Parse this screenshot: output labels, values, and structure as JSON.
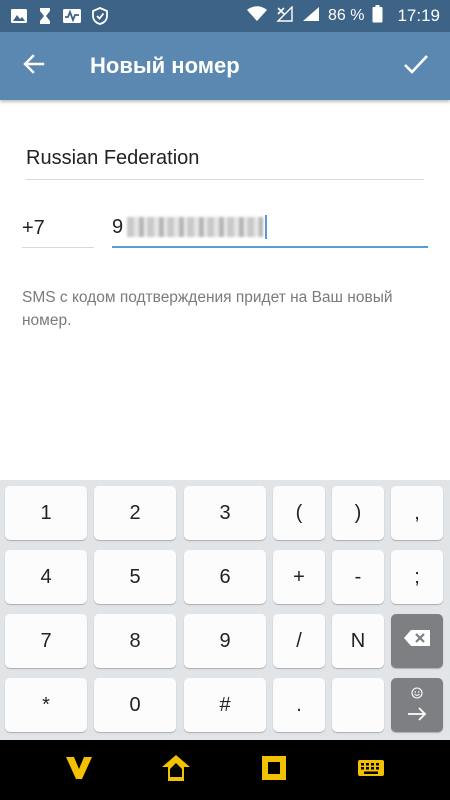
{
  "status_bar": {
    "icons": [
      "image-icon",
      "hourglass-icon",
      "activity-icon",
      "shield-icon",
      "wifi-icon",
      "no-signal-icon",
      "signal-icon"
    ],
    "battery": "86 %",
    "time": "17:19"
  },
  "app_bar": {
    "title": "Новый номер",
    "back_icon": "arrow-left-icon",
    "done_icon": "check-icon"
  },
  "form": {
    "country": "Russian Federation",
    "country_code": "+7",
    "phone_visible_prefix": "9",
    "hint": "SMS с кодом подтверждения придет на Ваш новый номер."
  },
  "keyboard": {
    "rows": [
      [
        "1",
        "2",
        "3",
        "(",
        ")",
        ","
      ],
      [
        "4",
        "5",
        "6",
        "+",
        "-",
        ";"
      ],
      [
        "7",
        "8",
        "9",
        "/",
        "N",
        "backspace"
      ],
      [
        "*",
        "0",
        "#",
        ".",
        "",
        "enter"
      ]
    ],
    "backspace_icon": "backspace-icon",
    "enter_icon": "arrow-right-icon",
    "emoji_icon": "smiley-icon"
  },
  "nav_bar": {
    "buttons": [
      "back-v-icon",
      "home-icon",
      "square-icon",
      "keyboard-icon"
    ],
    "accent": "#f2c200"
  },
  "colors": {
    "status_bar": "#3d6386",
    "app_bar": "#5b88b0",
    "input_accent": "#5b9bd5",
    "keyboard_bg": "#e2e5e8"
  }
}
